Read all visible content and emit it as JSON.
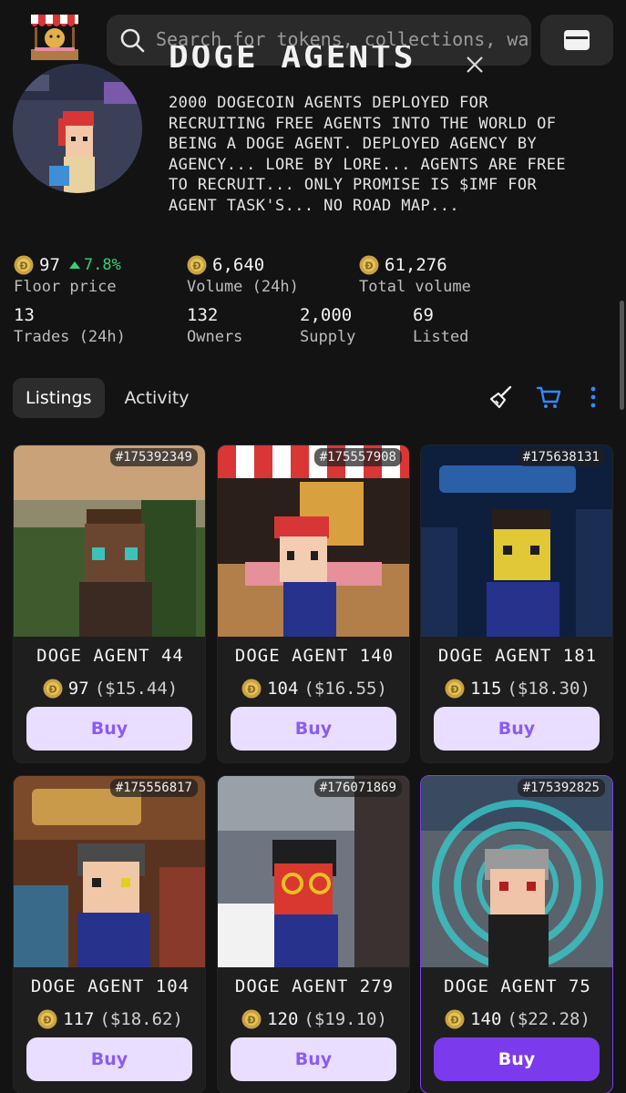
{
  "header": {
    "search_placeholder": "Search for tokens, collections, wa",
    "logo": "doge-market-stall-logo",
    "wallet_icon": "wallet-icon"
  },
  "collection": {
    "title": "DOGE AGENTS",
    "description": "2000 DOGECOIN AGENTS DEPLOYED FOR\nRECRUITING FREE AGENTS INTO THE WORLD OF\nBEING A DOGE AGENT. DEPLOYED AGENCY BY\nAGENCY... LORE BY LORE... AGENTS ARE FREE\nTO RECRUIT... ONLY PROMISE IS $IMF FOR\nAGENT TASK'S... NO ROAD MAP..."
  },
  "stats": {
    "floor_price": {
      "value": "97",
      "change": "7.8%",
      "label": "Floor price"
    },
    "volume_24h": {
      "value": "6,640",
      "label": "Volume (24h)"
    },
    "total_volume": {
      "value": "61,276",
      "label": "Total volume"
    },
    "trades_24h": {
      "value": "13",
      "label": "Trades (24h)"
    },
    "owners": {
      "value": "132",
      "label": "Owners"
    },
    "supply": {
      "value": "2,000",
      "label": "Supply"
    },
    "listed": {
      "value": "69",
      "label": "Listed"
    }
  },
  "tabs": [
    {
      "label": "Listings",
      "active": true
    },
    {
      "label": "Activity",
      "active": false
    }
  ],
  "colors": {
    "accent": "#7C3AED",
    "buy_bg": "#E9DEFF",
    "buy_text": "#8A5CF5",
    "positive": "#36D07A",
    "cart_icon": "#2F8BFF"
  },
  "listings": [
    {
      "id": "#175392349",
      "name": "DOGE AGENT 44",
      "price": "97",
      "usd": "($15.44)",
      "buy": "Buy",
      "selected": false
    },
    {
      "id": "#175557908",
      "name": "DOGE AGENT 140",
      "price": "104",
      "usd": "($16.55)",
      "buy": "Buy",
      "selected": false
    },
    {
      "id": "#175638131",
      "name": "DOGE AGENT 181",
      "price": "115",
      "usd": "($18.30)",
      "buy": "Buy",
      "selected": false
    },
    {
      "id": "#175556817",
      "name": "DOGE AGENT 104",
      "price": "117",
      "usd": "($18.62)",
      "buy": "Buy",
      "selected": false
    },
    {
      "id": "#176071869",
      "name": "DOGE AGENT 279",
      "price": "120",
      "usd": "($19.10)",
      "buy": "Buy",
      "selected": false
    },
    {
      "id": "#175392825",
      "name": "DOGE AGENT 75",
      "price": "140",
      "usd": "($22.28)",
      "buy": "Buy",
      "selected": true
    }
  ]
}
